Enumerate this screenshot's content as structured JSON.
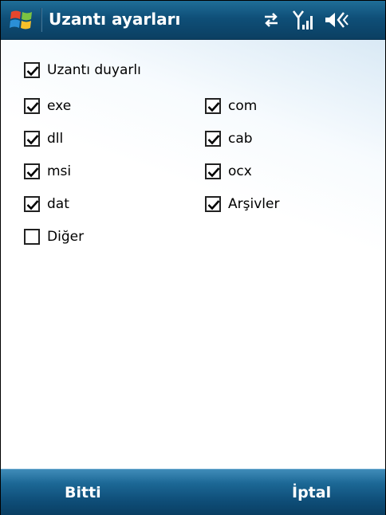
{
  "titlebar": {
    "title": "Uzantı ayarları",
    "icons": [
      "windows-start-icon",
      "sync-arrows-icon",
      "signal-strength-icon",
      "volume-icon"
    ]
  },
  "master_option": {
    "label": "Uzantı duyarlı",
    "checked": true
  },
  "extensions_left": [
    {
      "label": "exe",
      "checked": true
    },
    {
      "label": "dll",
      "checked": true
    },
    {
      "label": "msi",
      "checked": true
    },
    {
      "label": "dat",
      "checked": true
    },
    {
      "label": "Diğer",
      "checked": false
    }
  ],
  "extensions_right": [
    {
      "label": "com",
      "checked": true
    },
    {
      "label": "cab",
      "checked": true
    },
    {
      "label": "ocx",
      "checked": true
    },
    {
      "label": "Arşivler",
      "checked": true
    }
  ],
  "softkeys": {
    "left": "Bitti",
    "right": "İptal"
  },
  "colors": {
    "titlebar": "#0f4f78",
    "softbar": "#1c6896",
    "text": "#000000"
  }
}
